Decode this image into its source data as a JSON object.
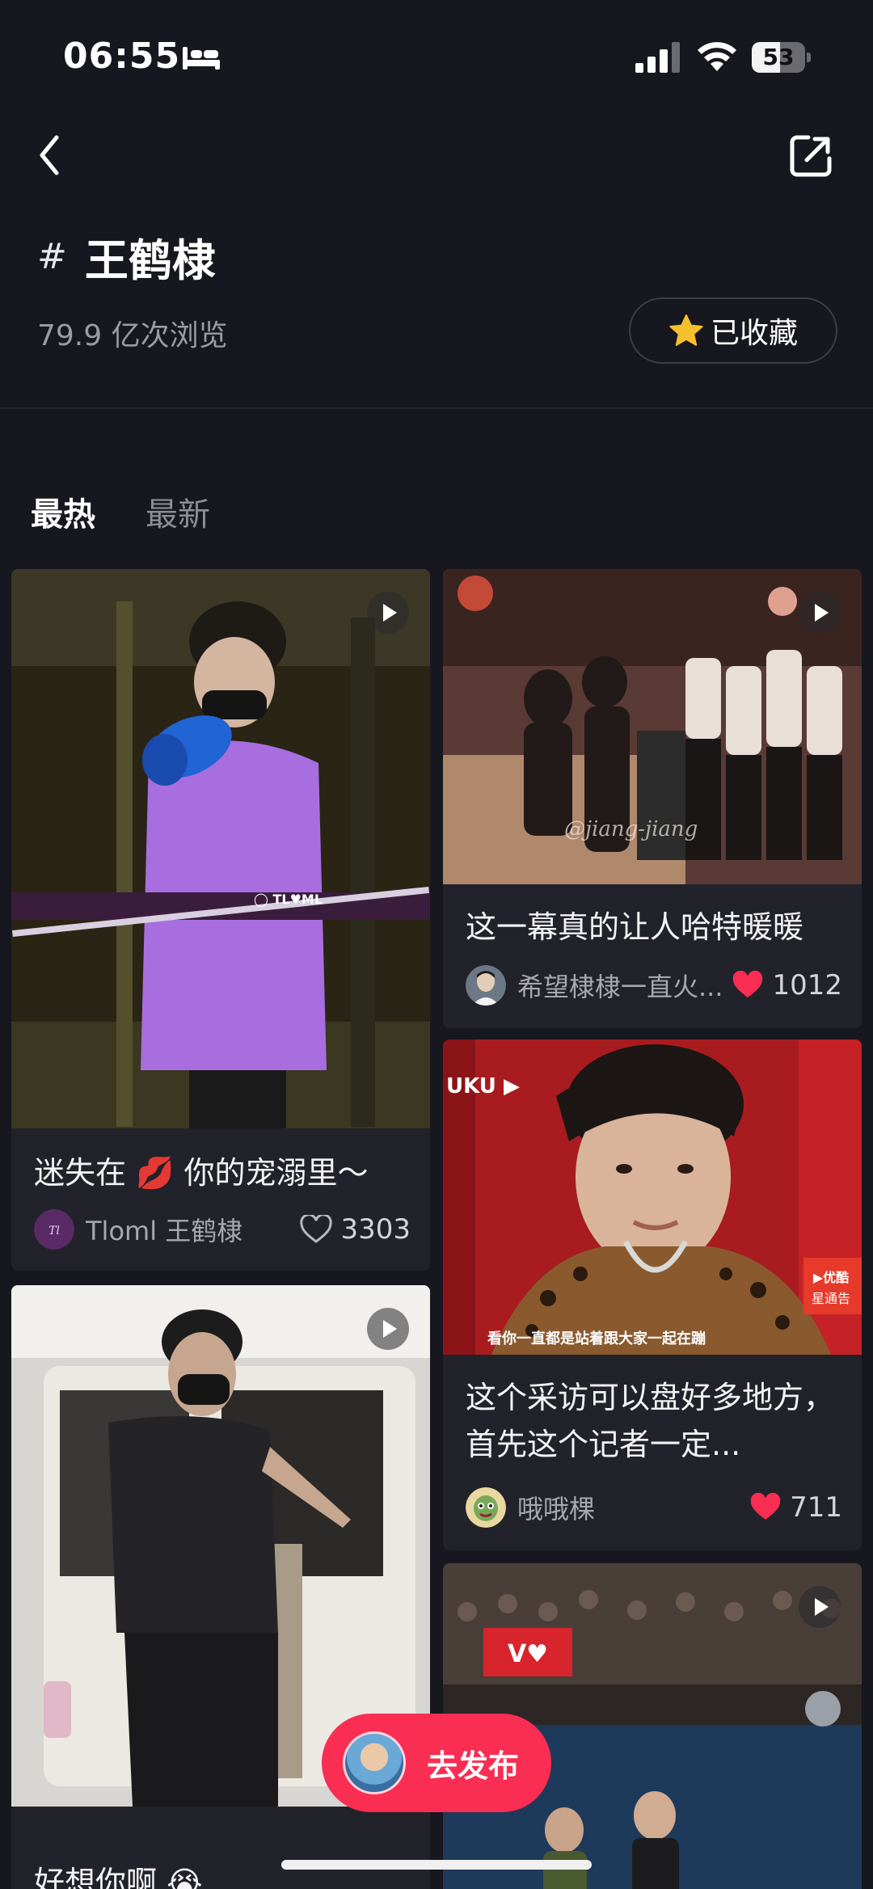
{
  "status_bar": {
    "time": "06:55",
    "battery": "53",
    "battery_level": 0.53
  },
  "topic": {
    "hash": "#",
    "name": "王鹤棣",
    "views": "79.9 亿次浏览"
  },
  "collect_button": {
    "label": "已收藏"
  },
  "tabs": [
    {
      "label": "最热",
      "active": true
    },
    {
      "label": "最新",
      "active": false
    }
  ],
  "feed": {
    "left": [
      {
        "title": "迷失在 💋 你的宠溺里～",
        "author": "Tloml 王鹤棣",
        "likes": "3303",
        "liked": false
      },
      {
        "title": "好想你啊 😭"
      }
    ],
    "right": [
      {
        "title": "这一幕真的让人哈特暖暖",
        "author": "希望棣棣一直火...",
        "likes": "1012",
        "liked": true
      },
      {
        "title": "这个采访可以盘好多地方，首先这个记者一定...",
        "author": "哦哦棵",
        "likes": "711",
        "liked": true
      },
      {
        "title": ""
      }
    ]
  },
  "publish_button": {
    "label": "去发布"
  },
  "colors": {
    "accent": "#fa2d52",
    "background": "#17171f",
    "card": "#22222a",
    "star": "#f5c02c"
  },
  "icons": [
    "back-icon",
    "share-icon",
    "star-icon",
    "play-icon",
    "heart-icon",
    "sleep-icon",
    "signal-icon",
    "wifi-icon"
  ]
}
